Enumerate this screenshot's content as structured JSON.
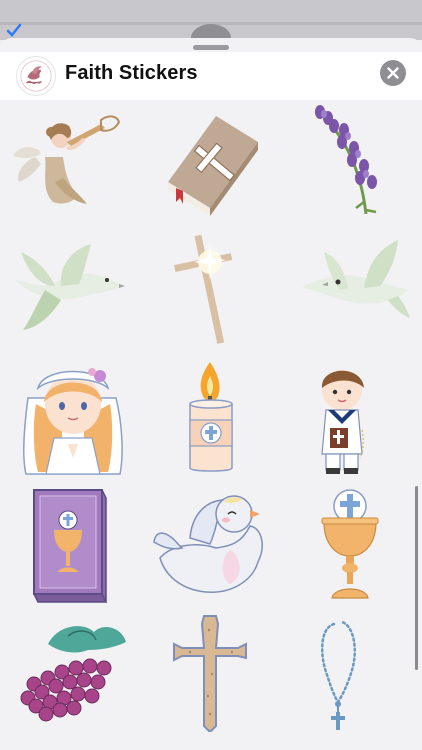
{
  "header": {
    "title": "Faith Stickers",
    "app_icon": "dove-olive-branch-icon",
    "close_icon": "close-icon"
  },
  "stickers": [
    {
      "name": "angel-trumpet"
    },
    {
      "name": "bible-with-cross"
    },
    {
      "name": "lavender-sprig"
    },
    {
      "name": "dove-flying-left"
    },
    {
      "name": "glowing-cross"
    },
    {
      "name": "dove-flying-right"
    },
    {
      "name": "communion-girl"
    },
    {
      "name": "candle-with-cross"
    },
    {
      "name": "communion-boy"
    },
    {
      "name": "purple-book-chalice"
    },
    {
      "name": "cute-dove"
    },
    {
      "name": "chalice-with-host"
    },
    {
      "name": "grapes"
    },
    {
      "name": "wooden-cross"
    },
    {
      "name": "rosary"
    }
  ],
  "colors": {
    "sheet_background": "#f2f2f4",
    "header_background": "#ffffff",
    "close_button": "#8e8e93"
  }
}
